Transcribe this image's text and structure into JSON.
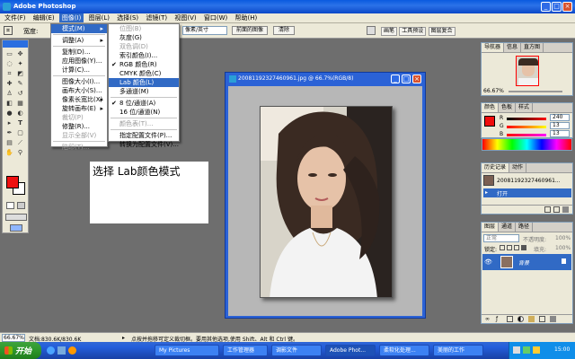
{
  "app": {
    "title": "Adobe Photoshop"
  },
  "menubar": [
    "文件(F)",
    "编辑(E)",
    "图像(I)",
    "图层(L)",
    "选择(S)",
    "滤镜(T)",
    "视图(V)",
    "窗口(W)",
    "帮助(H)"
  ],
  "options": {
    "width_label": "宽度:",
    "unit_select": "像素/英寸",
    "front_image": "前面的图像",
    "clear": "清除",
    "tabs": [
      "画笔",
      "工具预设",
      "图层复合"
    ]
  },
  "image_menu": {
    "items": [
      "模式(M)",
      "调整(A)",
      "复制(D)...",
      "应用图像(Y)...",
      "计算(C)...",
      "图像大小(I)...",
      "画布大小(S)...",
      "像素长宽比(X)",
      "旋转画布(E)",
      "裁切(P)",
      "修整(R)...",
      "显示全部(V)",
      "陷印(T)..."
    ]
  },
  "mode_menu": {
    "items": [
      "位图(B)",
      "灰度(G)",
      "双色调(D)",
      "索引颜色(I)...",
      "RGB 颜色(R)",
      "CMYK 颜色(C)",
      "Lab 颜色(L)",
      "多通道(M)",
      "8 位/通道(A)",
      "16 位/通道(N)",
      "颜色表(T)...",
      "指定配置文件(P)...",
      "转换为配置文件(V)..."
    ]
  },
  "annotation": "选择 Lab颜色模式",
  "document": {
    "title": "20081192327460961.jpg @ 66.7%(RGB/8)"
  },
  "navigator": {
    "tabs": [
      "导航器",
      "信息",
      "直方图"
    ],
    "zoom": "66.67%"
  },
  "color_panel": {
    "tabs": [
      "颜色",
      "色板",
      "样式"
    ],
    "channels": [
      {
        "label": "R",
        "value": "240"
      },
      {
        "label": "G",
        "value": "13"
      },
      {
        "label": "B",
        "value": "13"
      }
    ],
    "fg_color": "#f00d0d"
  },
  "history": {
    "tabs": [
      "历史记录",
      "动作"
    ],
    "snapshot": "20081192327460961...",
    "step": "打开"
  },
  "layers": {
    "tabs": [
      "图层",
      "通道",
      "路径"
    ],
    "blend": "正常",
    "opacity_label": "不透明度:",
    "opacity": "100%",
    "lock_label": "锁定:",
    "fill_label": "填充:",
    "fill": "100%",
    "layer_name": "背景"
  },
  "status": {
    "zoom": "66.67%",
    "doc": "文档:830.6K/830.6K",
    "hint": "点按并拖移可定义裁切框。要用其他选项,使用 Shift、Alt 和 Ctrl 键。"
  },
  "taskbar": {
    "start": "开始",
    "items": [
      "My Pictures",
      "工作管理器",
      "调影文件",
      "Adobe Phot...",
      "柔软化处理...",
      "美丽的工作"
    ],
    "clock": "15:00"
  }
}
